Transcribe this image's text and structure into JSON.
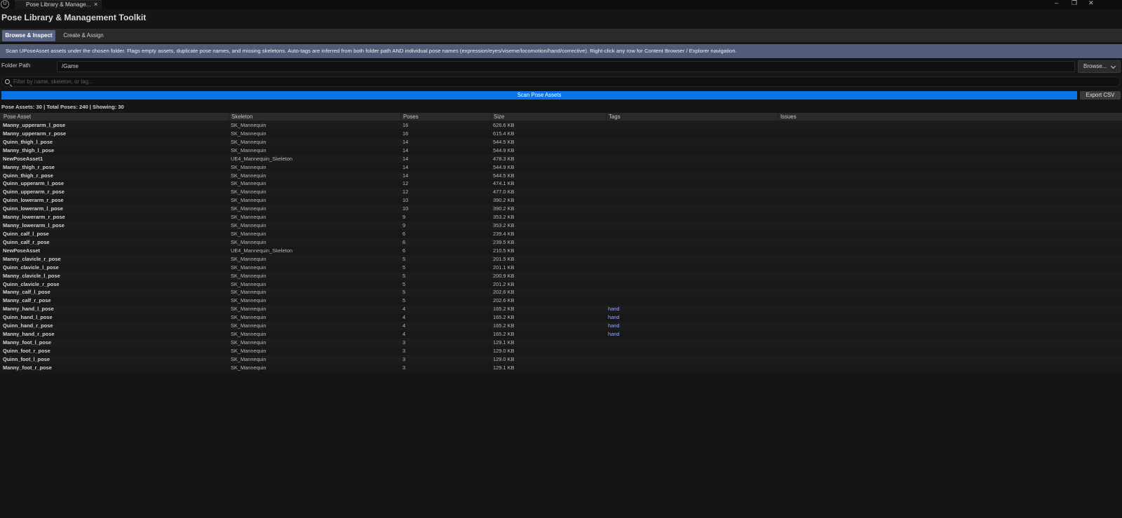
{
  "window": {
    "tab_title": "Pose Library & Manage...",
    "tab_close": "×",
    "minimize": "–",
    "maximize": "❐",
    "close": "✕",
    "logo": "U"
  },
  "header": {
    "title": "Pose Library & Management Toolkit"
  },
  "mode_tabs": [
    {
      "label": "Browse & Inspect",
      "active": true
    },
    {
      "label": "Create & Assign",
      "active": false
    }
  ],
  "banner": {
    "text": "Scan UPoseAsset assets under the chosen folder. Flags empty assets, duplicate pose names, and missing skeletons. Auto-tags are inferred from both folder path AND individual pose names (expression/eyes/viseme/locomotion/hand/corrective). Right-click any row for Content Browser / Explorer navigation."
  },
  "folder": {
    "label": "Folder Path",
    "value": "/Game",
    "browse_label": "Browse..."
  },
  "filter": {
    "placeholder": "Filter by name, skeleton, or tag..."
  },
  "actions": {
    "scan_label": "Scan Pose Assets",
    "export_label": "Export CSV"
  },
  "stats": {
    "text": "Pose Assets: 30  |  Total Poses: 240  |  Showing: 30"
  },
  "table": {
    "columns": [
      "Pose Asset",
      "Skeleton",
      "Poses",
      "Size",
      "Tags",
      "Issues"
    ],
    "rows": [
      [
        "Manny_upperarm_l_pose",
        "SK_Mannequin",
        "16",
        "626.6 KB",
        "",
        ""
      ],
      [
        "Manny_upperarm_r_pose",
        "SK_Mannequin",
        "16",
        "615.4 KB",
        "",
        ""
      ],
      [
        "Quinn_thigh_l_pose",
        "SK_Mannequin",
        "14",
        "544.5 KB",
        "",
        ""
      ],
      [
        "Manny_thigh_l_pose",
        "SK_Mannequin",
        "14",
        "544.9 KB",
        "",
        ""
      ],
      [
        "NewPoseAsset1",
        "UE4_Mannequin_Skeleton",
        "14",
        "478.3 KB",
        "",
        ""
      ],
      [
        "Manny_thigh_r_pose",
        "SK_Mannequin",
        "14",
        "544.9 KB",
        "",
        ""
      ],
      [
        "Quinn_thigh_r_pose",
        "SK_Mannequin",
        "14",
        "544.5 KB",
        "",
        ""
      ],
      [
        "Quinn_upperarm_l_pose",
        "SK_Mannequin",
        "12",
        "474.1 KB",
        "",
        ""
      ],
      [
        "Quinn_upperarm_r_pose",
        "SK_Mannequin",
        "12",
        "477.0 KB",
        "",
        ""
      ],
      [
        "Quinn_lowerarm_r_pose",
        "SK_Mannequin",
        "10",
        "390.2 KB",
        "",
        ""
      ],
      [
        "Quinn_lowerarm_l_pose",
        "SK_Mannequin",
        "10",
        "390.2 KB",
        "",
        ""
      ],
      [
        "Manny_lowerarm_r_pose",
        "SK_Mannequin",
        "9",
        "353.2 KB",
        "",
        ""
      ],
      [
        "Manny_lowerarm_l_pose",
        "SK_Mannequin",
        "9",
        "353.2 KB",
        "",
        ""
      ],
      [
        "Quinn_calf_l_pose",
        "SK_Mannequin",
        "6",
        "239.4 KB",
        "",
        ""
      ],
      [
        "Quinn_calf_r_pose",
        "SK_Mannequin",
        "6",
        "239.5 KB",
        "",
        ""
      ],
      [
        "NewPoseAsset",
        "UE4_Mannequin_Skeleton",
        "6",
        "210.5 KB",
        "",
        ""
      ],
      [
        "Manny_clavicle_r_pose",
        "SK_Mannequin",
        "5",
        "201.5 KB",
        "",
        ""
      ],
      [
        "Quinn_clavicle_l_pose",
        "SK_Mannequin",
        "5",
        "201.1 KB",
        "",
        ""
      ],
      [
        "Manny_clavicle_l_pose",
        "SK_Mannequin",
        "5",
        "200.9 KB",
        "",
        ""
      ],
      [
        "Quinn_clavicle_r_pose",
        "SK_Mannequin",
        "5",
        "201.2 KB",
        "",
        ""
      ],
      [
        "Manny_calf_l_pose",
        "SK_Mannequin",
        "5",
        "202.6 KB",
        "",
        ""
      ],
      [
        "Manny_calf_r_pose",
        "SK_Mannequin",
        "5",
        "202.6 KB",
        "",
        ""
      ],
      [
        "Manny_hand_l_pose",
        "SK_Mannequin",
        "4",
        "165.2 KB",
        "hand",
        ""
      ],
      [
        "Quinn_hand_l_pose",
        "SK_Mannequin",
        "4",
        "165.2 KB",
        "hand",
        ""
      ],
      [
        "Quinn_hand_r_pose",
        "SK_Mannequin",
        "4",
        "165.2 KB",
        "hand",
        ""
      ],
      [
        "Manny_hand_r_pose",
        "SK_Mannequin",
        "4",
        "165.2 KB",
        "hand",
        ""
      ],
      [
        "Manny_foot_l_pose",
        "SK_Mannequin",
        "3",
        "129.1 KB",
        "",
        ""
      ],
      [
        "Quinn_foot_r_pose",
        "SK_Mannequin",
        "3",
        "129.0 KB",
        "",
        ""
      ],
      [
        "Quinn_foot_l_pose",
        "SK_Mannequin",
        "3",
        "129.0 KB",
        "",
        ""
      ],
      [
        "Manny_foot_r_pose",
        "SK_Mannequin",
        "3",
        "129.1 KB",
        "",
        ""
      ]
    ]
  },
  "colors": {
    "background": "#151515",
    "active_tab": "#596487",
    "banner": "#525c78",
    "scan_button": "#0b73e8",
    "tag_text": "#9aa9f0"
  },
  "icons": [
    "unreal-logo-icon",
    "close-icon",
    "minimize-icon",
    "maximize-icon",
    "search-icon",
    "chevron-down-icon"
  ]
}
